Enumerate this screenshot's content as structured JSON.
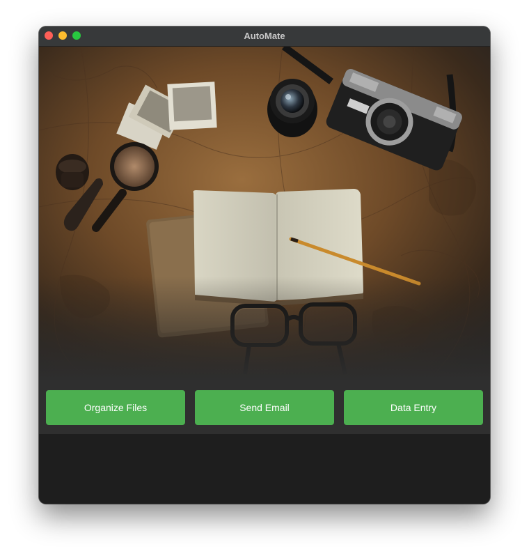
{
  "window": {
    "title": "AutoMate"
  },
  "hero_image": {
    "icon": "desk-photo",
    "description_colors": {
      "map": "#7a5530",
      "dark": "#2a2520"
    }
  },
  "actions": {
    "organize_files": "Organize Files",
    "send_email": "Send Email",
    "data_entry": "Data Entry"
  },
  "colors": {
    "button": "#4caf50",
    "titlebar": "#37393a",
    "background": "#1e1e1e"
  }
}
